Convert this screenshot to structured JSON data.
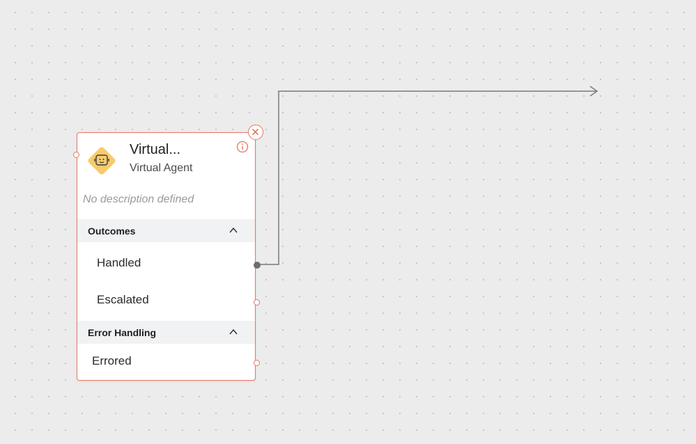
{
  "node": {
    "title": "Virtual...",
    "subtitle": "Virtual Agent",
    "description": "No description defined",
    "icon": "virtual-agent-icon",
    "accent_color": "#e8765f",
    "icon_color": "#f8cb6c",
    "outcomes": {
      "title": "Outcomes",
      "items": [
        {
          "label": "Handled",
          "connected": true
        },
        {
          "label": "Escalated",
          "connected": false
        }
      ]
    },
    "error_handling": {
      "title": "Error Handling",
      "items": [
        {
          "label": "Errored",
          "connected": false
        }
      ]
    }
  },
  "canvas": {
    "background_color": "#ececec",
    "connector_color": "#7a7a7a"
  }
}
